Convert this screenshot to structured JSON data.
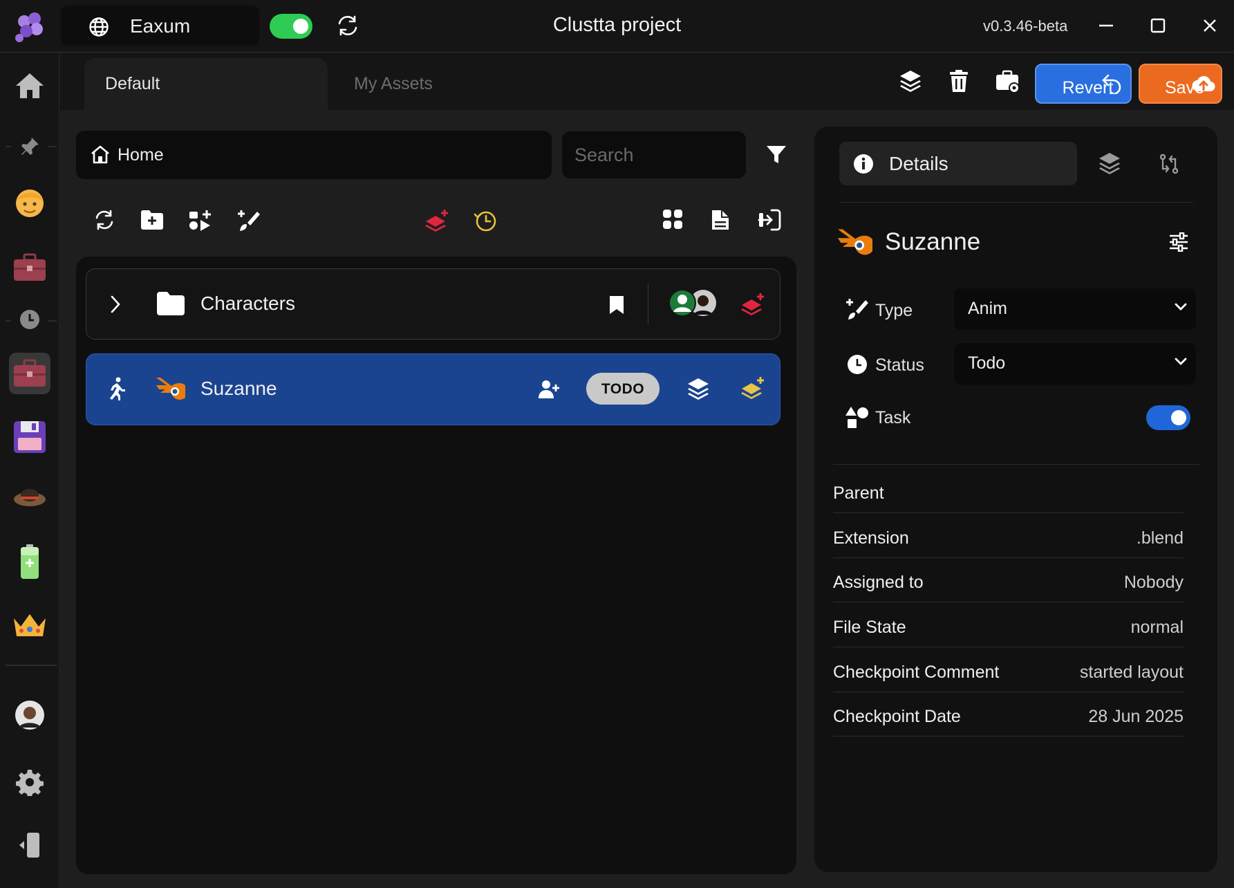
{
  "window": {
    "title": "Clustta project",
    "version": "v0.3.46-beta"
  },
  "project_selector": {
    "name": "Eaxum"
  },
  "tabs": [
    {
      "label": "Default"
    },
    {
      "label": "My Assets"
    }
  ],
  "toolbar": {
    "revert_label": "Revert",
    "save_label": "Save"
  },
  "breadcrumb": {
    "home_label": "Home"
  },
  "search": {
    "placeholder": "Search"
  },
  "list": {
    "rows": [
      {
        "name": "Characters",
        "kind": "folder"
      },
      {
        "name": "Suzanne",
        "kind": "blender-file",
        "status": "TODO"
      }
    ]
  },
  "details": {
    "tab_label": "Details",
    "asset_name": "Suzanne",
    "type_label": "Type",
    "type_value": "Anim",
    "status_label": "Status",
    "status_value": "Todo",
    "task_label": "Task",
    "task_enabled": true,
    "info": [
      {
        "key": "Parent",
        "value": ""
      },
      {
        "key": "Extension",
        "value": ".blend"
      },
      {
        "key": "Assigned to",
        "value": "Nobody"
      },
      {
        "key": "File State",
        "value": "normal"
      },
      {
        "key": "Checkpoint Comment",
        "value": "started layout"
      },
      {
        "key": "Checkpoint Date",
        "value": "28 Jun 2025"
      }
    ]
  },
  "colors": {
    "accent_blue": "#2a6fe0",
    "save_orange": "#ec6a1f",
    "selected_row": "#1b4490",
    "online_green": "#2ecc55",
    "blender_orange": "#e87d0d"
  }
}
